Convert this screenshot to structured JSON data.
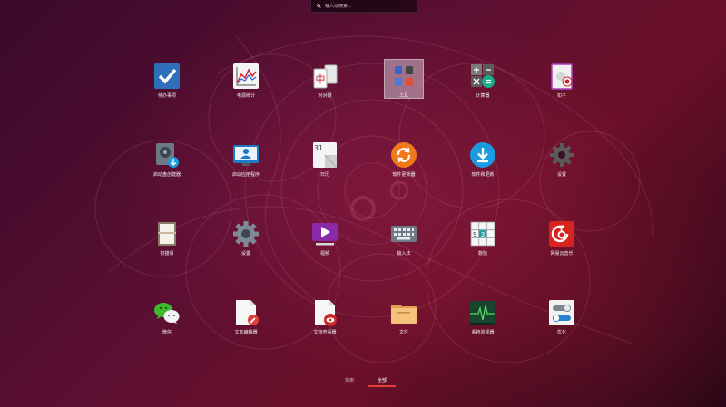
{
  "search": {
    "placeholder": "输入以搜索..."
  },
  "apps": [
    {
      "label": "待办事项"
    },
    {
      "label": "电源统计"
    },
    {
      "label": "对对碰"
    },
    {
      "label": "工具"
    },
    {
      "label": "计算器"
    },
    {
      "label": "扣子"
    },
    {
      "label": "启动盘创建器"
    },
    {
      "label": "启动应用程序"
    },
    {
      "label": "日历"
    },
    {
      "label": "软件更新器"
    },
    {
      "label": "软件和更新"
    },
    {
      "label": "设置"
    },
    {
      "label": "扫描易"
    },
    {
      "label": "设置"
    },
    {
      "label": "视频"
    },
    {
      "label": "输入法"
    },
    {
      "label": "数独"
    },
    {
      "label": "网易云音乐"
    },
    {
      "label": "微信"
    },
    {
      "label": "文本编辑器"
    },
    {
      "label": "文档查看器"
    },
    {
      "label": "文件"
    },
    {
      "label": "系统监视器"
    },
    {
      "label": "优化"
    }
  ],
  "icons": {
    "calendar_day": "31",
    "sudoku_digits": [
      "9",
      "3"
    ],
    "center_symbol": "中"
  },
  "tabs": [
    {
      "label": "常用"
    },
    {
      "label": "全部"
    }
  ],
  "colors": {
    "accent": "#e0403a",
    "selection": "#cdbecd"
  }
}
